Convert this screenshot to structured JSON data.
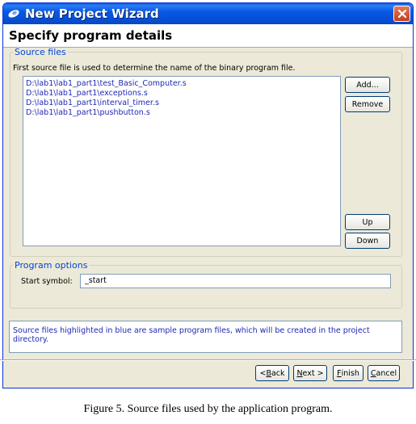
{
  "window": {
    "title": "New Project Wizard",
    "header": "Specify program details"
  },
  "source_files": {
    "legend": "Source files",
    "note": "First source file is used to determine the name of the binary program file.",
    "files": [
      "D:\\lab1\\lab1_part1\\test_Basic_Computer.s",
      "D:\\lab1\\lab1_part1\\exceptions.s",
      "D:\\lab1\\lab1_part1\\interval_timer.s",
      "D:\\lab1\\lab1_part1\\pushbutton.s"
    ],
    "buttons": {
      "add": "Add...",
      "remove": "Remove",
      "up": "Up",
      "down": "Down"
    }
  },
  "program_options": {
    "legend": "Program options",
    "start_symbol_label": "Start symbol:",
    "start_symbol_value": "_start"
  },
  "info": "Source files highlighted in blue are sample program files, which will be created in the project directory.",
  "footer": {
    "back": {
      "pre": "< ",
      "mnemonic": "B",
      "rest": "ack"
    },
    "next": {
      "mnemonic": "N",
      "rest": "ext >"
    },
    "finish": {
      "mnemonic": "F",
      "rest": "inish"
    },
    "cancel": {
      "mnemonic": "C",
      "rest": "ancel"
    }
  },
  "caption": "Figure 5. Source files used by the application program.",
  "colors": {
    "titlebar": "#0858e6",
    "legend": "#0046d5",
    "sample_file_text": "#1f28b3",
    "dialog_bg": "#ece9d8"
  },
  "icons": {
    "title": "eclipse-pin-icon",
    "close": "close-x-icon"
  }
}
